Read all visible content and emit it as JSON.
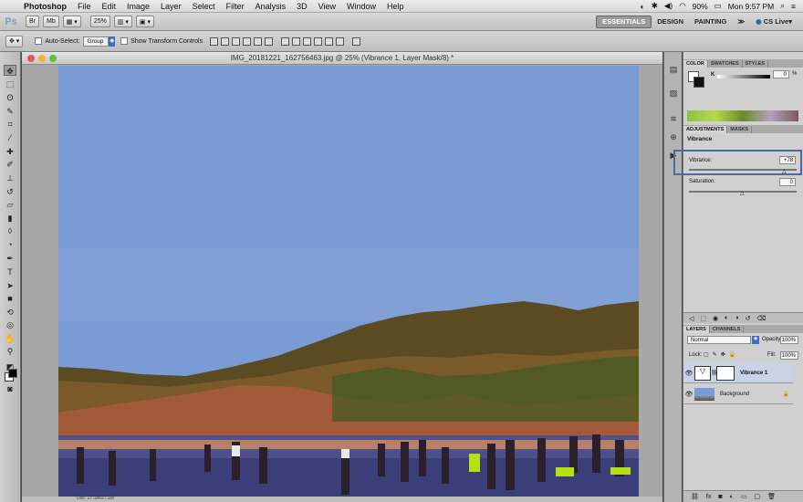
{
  "menubar": {
    "app": "Photoshop",
    "items": [
      "File",
      "Edit",
      "Image",
      "Layer",
      "Select",
      "Filter",
      "Analysis",
      "3D",
      "View",
      "Window",
      "Help"
    ],
    "battery": "90%",
    "clock": "Mon 9:57 PM"
  },
  "appbar": {
    "ps_label": "Ps",
    "zoom": "25%",
    "workspaces": [
      "ESSENTIALS",
      "DESIGN",
      "PAINTING"
    ],
    "more": "≫",
    "cslive": "CS Live"
  },
  "options": {
    "auto_select_label": "Auto-Select:",
    "auto_select_value": "Group",
    "show_transform_label": "Show Transform Controls"
  },
  "document": {
    "title": "IMG_20181221_162756463.jpg @ 25% (Vibrance 1, Layer Mask/8) *",
    "status": "Doc: 27.1M/27.1M"
  },
  "color_panel": {
    "tabs": [
      "COLOR",
      "SWATCHES",
      "STYLES"
    ],
    "channel": "K",
    "value": "0",
    "unit": "%"
  },
  "adjustments_panel": {
    "tabs": [
      "ADJUSTMENTS",
      "MASKS"
    ],
    "title": "Vibrance",
    "vibrance_label": "Vibrance:",
    "vibrance_value": "+78",
    "vibrance_fraction": 0.89,
    "saturation_label": "Saturation:",
    "saturation_value": "0",
    "saturation_fraction": 0.5
  },
  "layers_panel": {
    "tabs": [
      "LAYERS",
      "CHANNELS"
    ],
    "blend_mode": "Normal",
    "opacity_label": "Opacity:",
    "opacity_value": "100%",
    "lock_label": "Lock:",
    "fill_label": "Fill:",
    "fill_value": "100%",
    "layers": [
      {
        "name": "Vibrance 1"
      },
      {
        "name": "Background"
      }
    ]
  },
  "colors": {
    "highlight": "#4c6aa7",
    "sky": "#7a9bd4"
  }
}
